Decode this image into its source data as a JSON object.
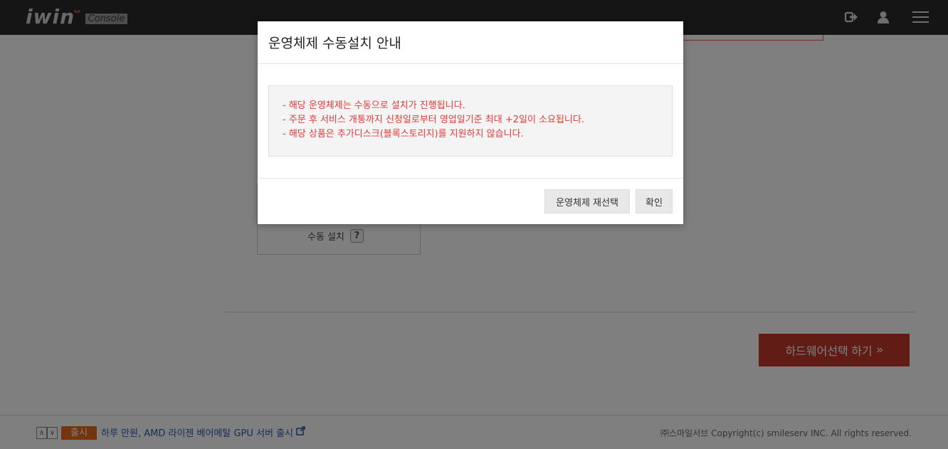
{
  "header": {
    "logo_text": "iwin",
    "logo_badge": "Console",
    "icons": [
      "logout-icon",
      "user-icon",
      "menu-icon"
    ]
  },
  "background": {
    "manual_install_label": "수동 설치",
    "help_symbol": "?",
    "hardware_button_label": "하드웨어선택 하기",
    "hardware_button_arrow": "»"
  },
  "footer": {
    "up_arrow": "∧",
    "down_arrow": "∨",
    "news_badge": "출시",
    "news_text": "하루 만원, AMD 라이젠 베어메탈 GPU 서버 출시",
    "copyright": "㈜스마일서브 Copyright(c) smileserv INC. All rights reserved."
  },
  "modal": {
    "title": "운영체제 수동설치 안내",
    "notices": [
      "- 해당 운영체제는 수동으로 설치가 진행됩니다.",
      "- 주문 후 서비스 개통까지 신청일로부터 영업일기준 최대 +2일이 소요됩니다.",
      "- 해당 상품은 추가디스크(블록스토리지)를 지원하지 않습니다."
    ],
    "reselect_button": "운영체제 재선택",
    "confirm_button": "확인"
  },
  "colors": {
    "header_bg": "#2b2b2b",
    "accent_red": "#c0392b",
    "notice_text": "#e03a3a",
    "badge_orange": "#e86a1c"
  }
}
